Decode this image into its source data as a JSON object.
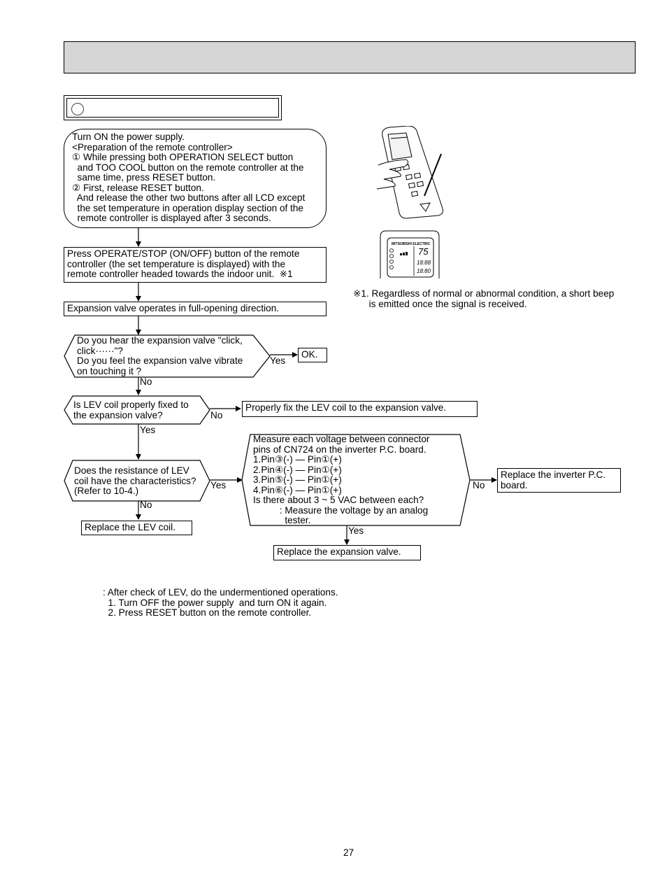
{
  "header": {
    "title": ""
  },
  "section": {
    "title": ""
  },
  "flow": {
    "start": {
      "lines": [
        "Turn ON the power supply.",
        "<Preparation of the remote controller>",
        "① While pressing both OPERATION SELECT button",
        "  and TOO COOL button on the remote controller at the",
        "  same time, press RESET button.",
        "② First, release RESET button.",
        "  And release the other two buttons after all LCD except",
        "  the set temperature in operation display section of the",
        "  remote controller is displayed after 3 seconds."
      ]
    },
    "step_operate": {
      "lines": [
        "Press OPERATE/STOP (ON/OFF) button of the remote",
        "controller (the set temperature is displayed) with the",
        "remote controller headed towards the indoor unit.  ※1"
      ]
    },
    "step_expansion": "Expansion valve operates in full-opening direction.",
    "decision_click": {
      "lines": [
        "Do you hear the expansion valve \"click,",
        "click······\"?",
        "Do you feel the expansion valve vibrate",
        "on touching it ?"
      ],
      "yes_label": "Yes",
      "no_label": "No"
    },
    "result_ok": "OK.",
    "decision_fixed": {
      "lines": [
        "Is LEV coil properly fixed to",
        "the expansion valve?"
      ],
      "no_label": "No",
      "yes_label": "Yes"
    },
    "action_fix": "Properly fix the LEV coil to the expansion valve.",
    "decision_resistance": {
      "lines": [
        "Does the resistance of LEV",
        "coil have the characteristics?",
        "(Refer to 10-4.)"
      ],
      "yes_label": "Yes",
      "no_label": "No"
    },
    "action_replace_coil": "Replace the LEV coil.",
    "decision_voltage": {
      "lines": [
        "Measure each voltage between connector",
        "pins of CN724 on the inverter P.C. board.",
        "1.Pin③(-) — Pin①(+)",
        "2.Pin④(-) — Pin①(+)",
        "3.Pin⑤(-) — Pin①(+)",
        "4.Pin⑥(-) — Pin①(+)",
        "Is there about 3 ~ 5 VAC between each?",
        "          : Measure the voltage by an analog",
        "            tester."
      ],
      "no_label": "No",
      "yes_label": "Yes"
    },
    "action_replace_board": {
      "lines": [
        "Replace the inverter P.C.",
        "board."
      ]
    },
    "action_replace_valve": "Replace the expansion valve."
  },
  "figures": {
    "remote_hand": "remote-controller-pressing-buttons",
    "remote_lcd": {
      "brand": "MITSUBISHI ELECTRIC",
      "temp": "75",
      "time1": "18:88",
      "time2": "18:80"
    }
  },
  "note1": {
    "lines": [
      "※1. Regardless of normal or abnormal condition, a short beep",
      "      is emitted once the signal is received."
    ]
  },
  "footer_note": {
    "lines": [
      ": After check of LEV, do the undermentioned operations.",
      "  1. Turn OFF the power supply  and turn ON it again.",
      "  2. Press RESET button on the remote controller."
    ]
  },
  "page_number": "27"
}
